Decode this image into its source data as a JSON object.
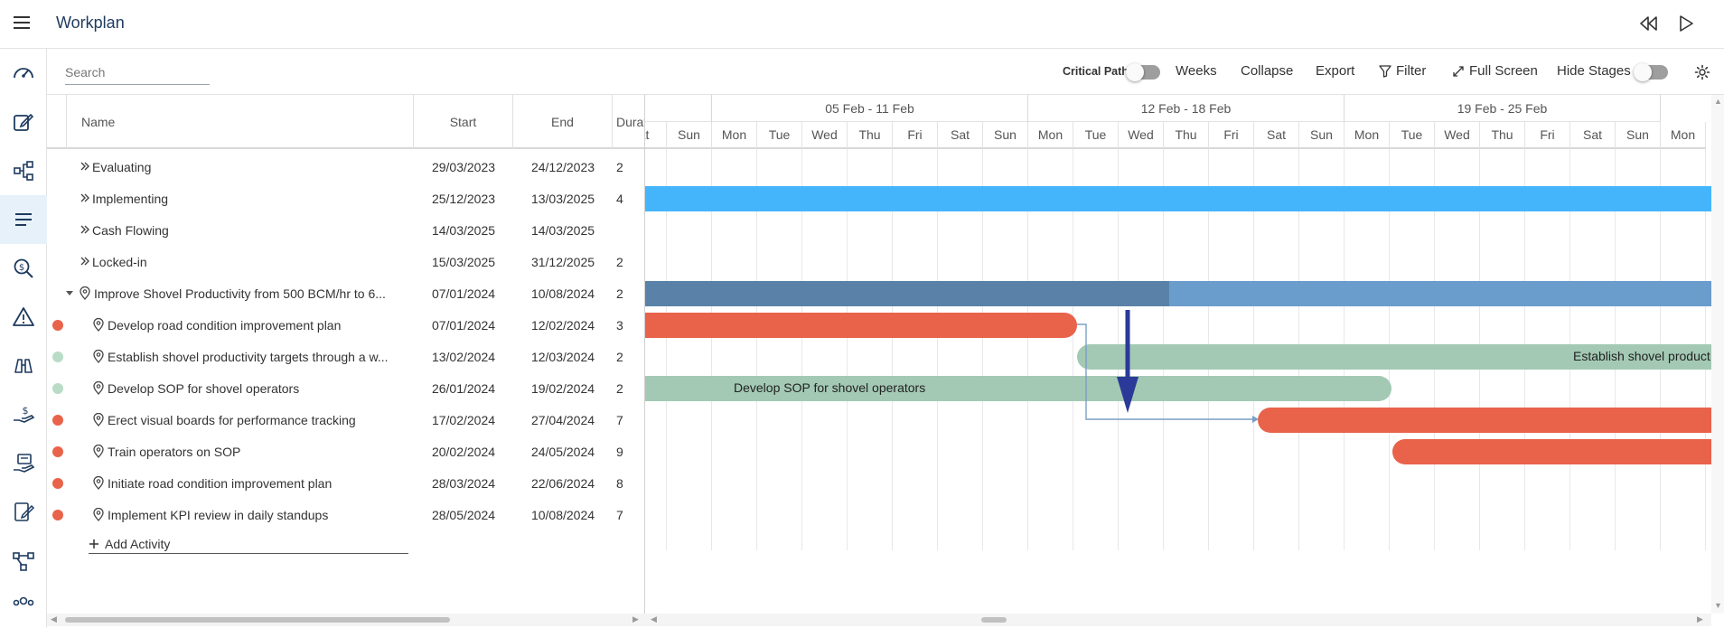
{
  "app": {
    "title": "Workplan"
  },
  "toolbar": {
    "search_placeholder": "Search",
    "critical_path": "Critical Path",
    "weeks": "Weeks",
    "collapse": "Collapse",
    "export": "Export",
    "filter": "Filter",
    "full_screen": "Full Screen",
    "hide_stages": "Hide Stages"
  },
  "grid": {
    "columns": {
      "name": "Name",
      "start": "Start",
      "end": "End",
      "duration": "Duration"
    },
    "rows": [
      {
        "name": "Evaluating",
        "start": "29/03/2023",
        "end": "24/12/2023",
        "duration": "2",
        "type": "stage"
      },
      {
        "name": "Implementing",
        "start": "25/12/2023",
        "end": "13/03/2025",
        "duration": "4",
        "type": "stage"
      },
      {
        "name": "Cash Flowing",
        "start": "14/03/2025",
        "end": "14/03/2025",
        "duration": "",
        "type": "stage"
      },
      {
        "name": "Locked-in",
        "start": "15/03/2025",
        "end": "31/12/2025",
        "duration": "2",
        "type": "stage"
      },
      {
        "name": "Improve Shovel Productivity from 500 BCM/hr to 6...",
        "start": "07/01/2024",
        "end": "10/08/2024",
        "duration": "2",
        "type": "initiative"
      },
      {
        "name": "Develop road condition improvement plan",
        "start": "07/01/2024",
        "end": "12/02/2024",
        "duration": "3",
        "type": "activity",
        "status_color": "#e8634a"
      },
      {
        "name": "Establish shovel productivity targets through a w...",
        "start": "13/02/2024",
        "end": "12/03/2024",
        "duration": "2",
        "type": "activity",
        "status_color": "#b8dcc6"
      },
      {
        "name": "Develop SOP for shovel operators",
        "start": "26/01/2024",
        "end": "19/02/2024",
        "duration": "2",
        "type": "activity",
        "status_color": "#b8dcc6"
      },
      {
        "name": "Erect visual boards for performance tracking",
        "start": "17/02/2024",
        "end": "27/04/2024",
        "duration": "7",
        "type": "activity",
        "status_color": "#e8634a"
      },
      {
        "name": "Train operators on SOP",
        "start": "20/02/2024",
        "end": "24/05/2024",
        "duration": "9",
        "type": "activity",
        "status_color": "#e8634a"
      },
      {
        "name": "Initiate road condition improvement plan",
        "start": "28/03/2024",
        "end": "22/06/2024",
        "duration": "8",
        "type": "activity",
        "status_color": "#e8634a"
      },
      {
        "name": "Implement KPI review in daily standups",
        "start": "28/05/2024",
        "end": "10/08/2024",
        "duration": "7",
        "type": "activity",
        "status_color": "#e8634a"
      }
    ],
    "add_activity": "Add Activity"
  },
  "gantt": {
    "weeks": [
      "05 Feb - 11 Feb",
      "12 Feb - 18 Feb",
      "19 Feb - 25 Feb"
    ],
    "days": [
      "at",
      "Sun",
      "Mon",
      "Tue",
      "Wed",
      "Thu",
      "Fri",
      "Sat",
      "Sun",
      "Mon",
      "Tue",
      "Wed",
      "Thu",
      "Fri",
      "Sat",
      "Sun",
      "Mon",
      "Tue",
      "Wed",
      "Thu",
      "Fri",
      "Sat",
      "Sun",
      "Mon"
    ],
    "bar_labels": {
      "establish": "Establish shovel product",
      "sop": "Develop SOP for shovel operators"
    }
  },
  "colors": {
    "stage_blue": "#45b5fb",
    "initiative_dark": "#5a82a8",
    "initiative_light": "#6a9ccc",
    "at_risk": "#e8634a",
    "on_track": "#a3c9b4",
    "connector": "#7a9fc4",
    "annotation_arrow": "#2b3a99"
  }
}
